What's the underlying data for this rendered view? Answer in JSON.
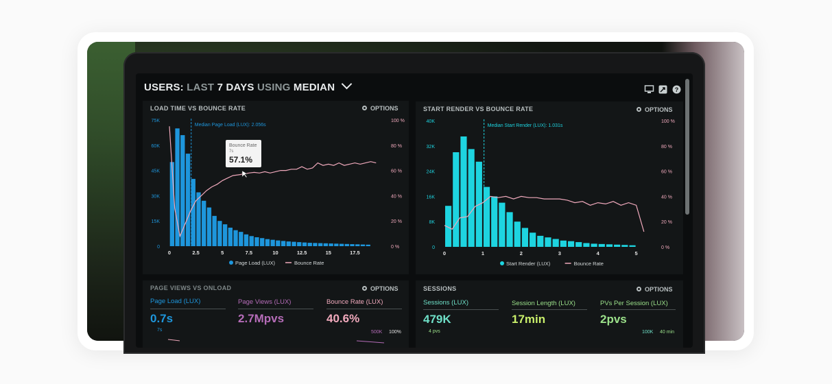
{
  "header": {
    "title_a": "USERS:",
    "title_b": "LAST",
    "title_c": "7 DAYS",
    "title_d": "USING",
    "title_e": "MEDIAN",
    "icons": [
      "monitor-icon",
      "share-icon",
      "help-icon"
    ]
  },
  "options_label": "OPTIONS",
  "panels": {
    "left_chart": {
      "title": "LOAD TIME VS BOUNCE RATE",
      "annotation": "Median Page Load (LUX): 2.056s",
      "tooltip_title": "Bounce Rate",
      "tooltip_sub": "7s",
      "tooltip_value": "57.1%",
      "legend_a": "Page Load (LUX)",
      "legend_b": "Bounce Rate"
    },
    "right_chart": {
      "title": "START RENDER VS BOUNCE RATE",
      "annotation": "Median Start Render (LUX): 1.031s",
      "legend_a": "Start Render (LUX)",
      "legend_b": "Bounce Rate"
    },
    "page_views": {
      "title": "PAGE VIEWS VS ONLOAD",
      "m1_label": "Page Load (LUX)",
      "m1_value": "0.7s",
      "m2_label": "Page Views (LUX)",
      "m2_value": "2.7Mpvs",
      "m3_label": "Bounce Rate (LUX)",
      "m3_value": "40.6%",
      "foot_a": "7s",
      "foot_b": "500K",
      "foot_c": "100%"
    },
    "sessions": {
      "title": "SESSIONS",
      "m1_label": "Sessions (LUX)",
      "m1_value": "479K",
      "m2_label": "Session Length (LUX)",
      "m2_value": "17min",
      "m3_label": "PVs Per Session (LUX)",
      "m3_value": "2pvs",
      "foot_a": "4 pvs",
      "foot_b": "100K",
      "foot_c": "40 min"
    }
  },
  "colors": {
    "blue": "#1e96dc",
    "cyan": "#1ed4e0",
    "pink": "#f0a9bc",
    "magenta": "#b56cb8",
    "green": "#9be08a",
    "teal_text": "#6fe0c8"
  },
  "chart_data": [
    {
      "type": "bar",
      "title": "LOAD TIME VS BOUNCE RATE",
      "x_ticks": [
        "0",
        "2.5",
        "5",
        "7.5",
        "10",
        "12.5",
        "15",
        "17.5"
      ],
      "y_left_ticks": [
        "0",
        "15K",
        "30K",
        "45K",
        "60K",
        "75K"
      ],
      "y_right_ticks": [
        "0 %",
        "20 %",
        "40 %",
        "60 %",
        "80 %",
        "100 %"
      ],
      "xlim": [
        0,
        20
      ],
      "ylim_left": [
        0,
        75000
      ],
      "ylim_right": [
        0,
        100
      ],
      "series": [
        {
          "name": "Page Load (LUX)",
          "type": "bar",
          "x": [
            0.25,
            0.75,
            1.25,
            1.75,
            2.25,
            2.75,
            3.25,
            3.75,
            4.25,
            4.75,
            5.25,
            5.75,
            6.25,
            6.75,
            7.25,
            7.75,
            8.25,
            8.75,
            9.25,
            9.75,
            10.25,
            10.75,
            11.25,
            11.75,
            12.25,
            12.75,
            13.25,
            13.75,
            14.25,
            14.75,
            15.25,
            15.75,
            16.25,
            16.75,
            17.25,
            17.75,
            18.25,
            18.75
          ],
          "values": [
            50000,
            70000,
            66000,
            55000,
            40000,
            32000,
            27000,
            23000,
            18000,
            15000,
            13000,
            11000,
            9500,
            8500,
            7000,
            6000,
            5300,
            4800,
            4200,
            3800,
            3400,
            3100,
            2800,
            2600,
            2400,
            2200,
            2000,
            1900,
            1800,
            1700,
            1600,
            1500,
            1400,
            1300,
            1200,
            1100,
            1000,
            900
          ]
        },
        {
          "name": "Bounce Rate",
          "type": "line",
          "x": [
            0,
            0.5,
            1,
            1.5,
            2,
            2.5,
            3,
            3.5,
            4,
            4.5,
            5,
            5.5,
            6,
            6.5,
            7,
            7.5,
            8,
            8.5,
            9,
            9.5,
            10,
            10.5,
            11,
            11.5,
            12,
            12.5,
            13,
            13.5,
            14,
            14.5,
            15,
            15.5,
            16,
            16.5,
            17,
            17.5,
            18,
            18.5,
            19,
            19.5
          ],
          "values": [
            95,
            30,
            8,
            18,
            28,
            36,
            40,
            44,
            47,
            49,
            52,
            54,
            56,
            56.5,
            57.1,
            58,
            58.5,
            58,
            59,
            58,
            59,
            60,
            60,
            61,
            61,
            63,
            61,
            62,
            66,
            64,
            65,
            64,
            66,
            64,
            65,
            66,
            65,
            66,
            67,
            66
          ]
        }
      ],
      "annotation": "Median Page Load (LUX): 2.056s"
    },
    {
      "type": "bar",
      "title": "START RENDER VS BOUNCE RATE",
      "x_ticks": [
        "0",
        "1",
        "2",
        "3",
        "4",
        "5"
      ],
      "y_left_ticks": [
        "0",
        "8K",
        "16K",
        "24K",
        "32K",
        "40K"
      ],
      "y_right_ticks": [
        "0 %",
        "20 %",
        "40 %",
        "60 %",
        "80 %",
        "100 %"
      ],
      "xlim": [
        0,
        5.4
      ],
      "ylim_left": [
        0,
        40000
      ],
      "ylim_right": [
        0,
        100
      ],
      "series": [
        {
          "name": "Start Render (LUX)",
          "type": "bar",
          "x": [
            0.1,
            0.3,
            0.5,
            0.7,
            0.9,
            1.1,
            1.3,
            1.5,
            1.7,
            1.9,
            2.1,
            2.3,
            2.5,
            2.7,
            2.9,
            3.1,
            3.3,
            3.5,
            3.7,
            3.9,
            4.1,
            4.3,
            4.5,
            4.7,
            4.9
          ],
          "values": [
            13000,
            30000,
            35000,
            31000,
            27000,
            19000,
            16000,
            14000,
            11000,
            8000,
            6000,
            4500,
            3500,
            3000,
            2500,
            2000,
            1800,
            1500,
            1200,
            1000,
            900,
            800,
            700,
            600,
            500
          ]
        },
        {
          "name": "Bounce Rate",
          "type": "line",
          "x": [
            0,
            0.2,
            0.4,
            0.6,
            0.8,
            1,
            1.2,
            1.4,
            1.6,
            1.8,
            2,
            2.2,
            2.4,
            2.6,
            2.8,
            3,
            3.2,
            3.4,
            3.6,
            3.8,
            4,
            4.2,
            4.4,
            4.6,
            4.8,
            5,
            5.2
          ],
          "values": [
            17,
            14,
            23,
            24,
            32,
            35,
            40,
            39,
            40,
            38,
            40,
            39,
            39,
            38,
            38,
            38,
            37,
            35,
            36,
            33,
            35,
            34,
            36,
            33,
            35,
            33,
            12
          ]
        }
      ],
      "annotation": "Median Start Render (LUX): 1.031s"
    }
  ]
}
